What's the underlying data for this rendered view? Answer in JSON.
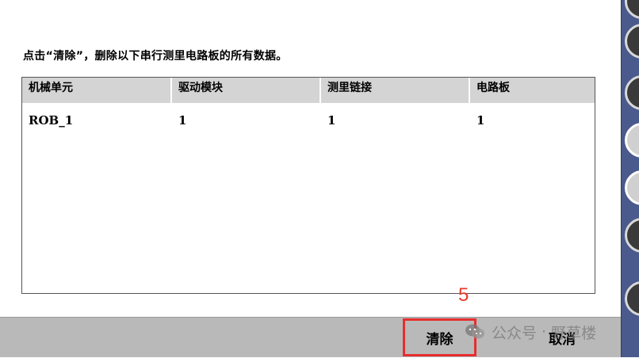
{
  "instruction": "点击“清除”，删除以下串行测里电路板的所有数据。",
  "table": {
    "columns": [
      "机械单元",
      "驱动模块",
      "测里链接",
      "电路板"
    ],
    "rows": [
      [
        "ROB_1",
        "1",
        "1",
        "1"
      ]
    ]
  },
  "footer": {
    "clear_label": "清除",
    "cancel_label": "取消"
  },
  "annotation": {
    "step": "5",
    "color": "#e62e2e"
  },
  "watermark": {
    "prefix": "公众号",
    "separator": "·",
    "name": "野草楼",
    "icon": "wechat-icon"
  },
  "rail": {
    "icons": [
      "round-button-icon",
      "round-button-icon",
      "round-button-icon",
      "round-button-icon",
      "round-button-icon",
      "round-button-icon",
      "round-button-icon"
    ]
  }
}
